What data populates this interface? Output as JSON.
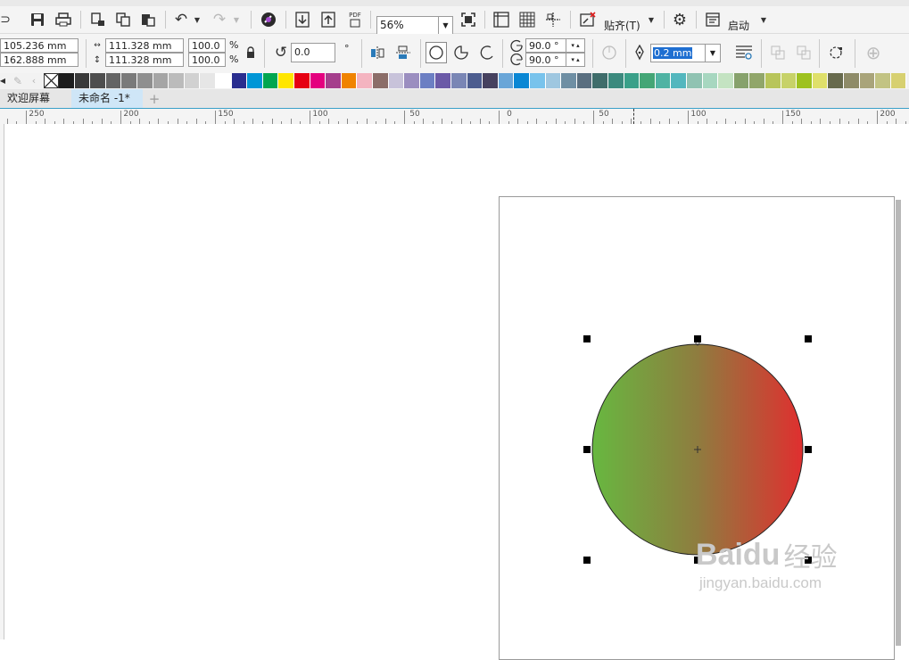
{
  "toolbar": {
    "zoom": "56%",
    "snap_label": "贴齐(T)",
    "launch_label": "启动",
    "pdf_label": "PDF"
  },
  "property_bar": {
    "x": "105.236 mm",
    "y": "162.888 mm",
    "width": "111.328 mm",
    "height": "111.328 mm",
    "scale_x": "100.0",
    "scale_y": "100.0",
    "percent": "%",
    "rotation": "0.0",
    "degree_symbol": "°",
    "start_angle": "90.0 °",
    "end_angle": "90.0 °",
    "outline_width": "0.2 mm"
  },
  "palette": {
    "colors": [
      "#1d1d1d",
      "#3a3a3a",
      "#4e4e4e",
      "#646464",
      "#7a7a7a",
      "#8f8f8f",
      "#a5a5a5",
      "#bbbbbb",
      "#d1d1d1",
      "#e6e6e6",
      "#ffffff",
      "#2a2e8f",
      "#0096d6",
      "#00a650",
      "#ffe600",
      "#e60012",
      "#e4007f",
      "#a53e8c",
      "#f08300",
      "#f4b4c0",
      "#8c6e69",
      "#c8c3da",
      "#9b8ec0",
      "#6c7fc3",
      "#6b5aa7",
      "#7a86b5",
      "#4d5d8f",
      "#46415f",
      "#6aa6d8",
      "#0a87d4",
      "#78c3ec",
      "#9fc7e0",
      "#6f8fa4",
      "#5a6f80",
      "#3f6d6b",
      "#3c8a7e",
      "#3aa089",
      "#44a676",
      "#4fb3a3",
      "#53b7be",
      "#90c3b2",
      "#a7d7c0",
      "#c4e3c2",
      "#87a26c",
      "#91a66a",
      "#b8c55a",
      "#c7d268",
      "#9ec21f",
      "#dfe06a",
      "#676a4d",
      "#8e8b68",
      "#a9a47a",
      "#c2c383",
      "#d7d070"
    ]
  },
  "tabs": [
    {
      "label": "欢迎屏幕",
      "active": false
    },
    {
      "label": "未命名 -1*",
      "active": true
    }
  ],
  "ruler": {
    "labels": [
      "250",
      "200",
      "150",
      "100",
      "50",
      "0",
      "50",
      "100",
      "150",
      "200"
    ]
  },
  "shape": {
    "type": "ellipse",
    "fill": "linear-gradient",
    "fill_start": "#67b840",
    "fill_mid": "#8f7c3f",
    "fill_end": "#e02f2f"
  },
  "watermark": {
    "brand": "Baidu",
    "brand_suffix": "经验",
    "url": "jingyan.baidu.com"
  }
}
